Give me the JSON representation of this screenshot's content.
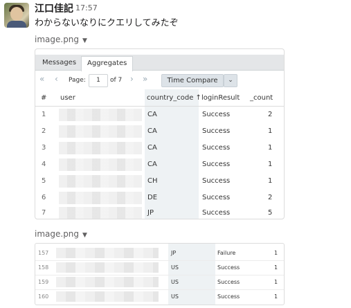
{
  "message": {
    "sender": "江口佳記",
    "time": "17:57",
    "text": "わからないなりにクエリしてみたぞ"
  },
  "attachments": [
    {
      "label": "image.png"
    },
    {
      "label": "image.png"
    }
  ],
  "table1": {
    "tabs": [
      "Messages",
      "Aggregates"
    ],
    "pager": {
      "page_label": "Page:",
      "page_value": "1",
      "of_label": "of 7",
      "time_compare": "Time Compare"
    },
    "headers": [
      "#",
      "user",
      "country_code ↑",
      "loginResult",
      "_count"
    ],
    "rows": [
      [
        "1",
        "CA",
        "Success",
        "2"
      ],
      [
        "2",
        "CA",
        "Success",
        "1"
      ],
      [
        "3",
        "CA",
        "Success",
        "1"
      ],
      [
        "4",
        "CA",
        "Success",
        "1"
      ],
      [
        "5",
        "CH",
        "Success",
        "1"
      ],
      [
        "6",
        "DE",
        "Success",
        "2"
      ],
      [
        "7",
        "JP",
        "Success",
        "5"
      ]
    ]
  },
  "table2": {
    "rows": [
      [
        "157",
        "JP",
        "Failure",
        "1"
      ],
      [
        "158",
        "US",
        "Success",
        "1"
      ],
      [
        "159",
        "US",
        "Success",
        "1"
      ],
      [
        "160",
        "US",
        "Success",
        "1"
      ]
    ]
  }
}
